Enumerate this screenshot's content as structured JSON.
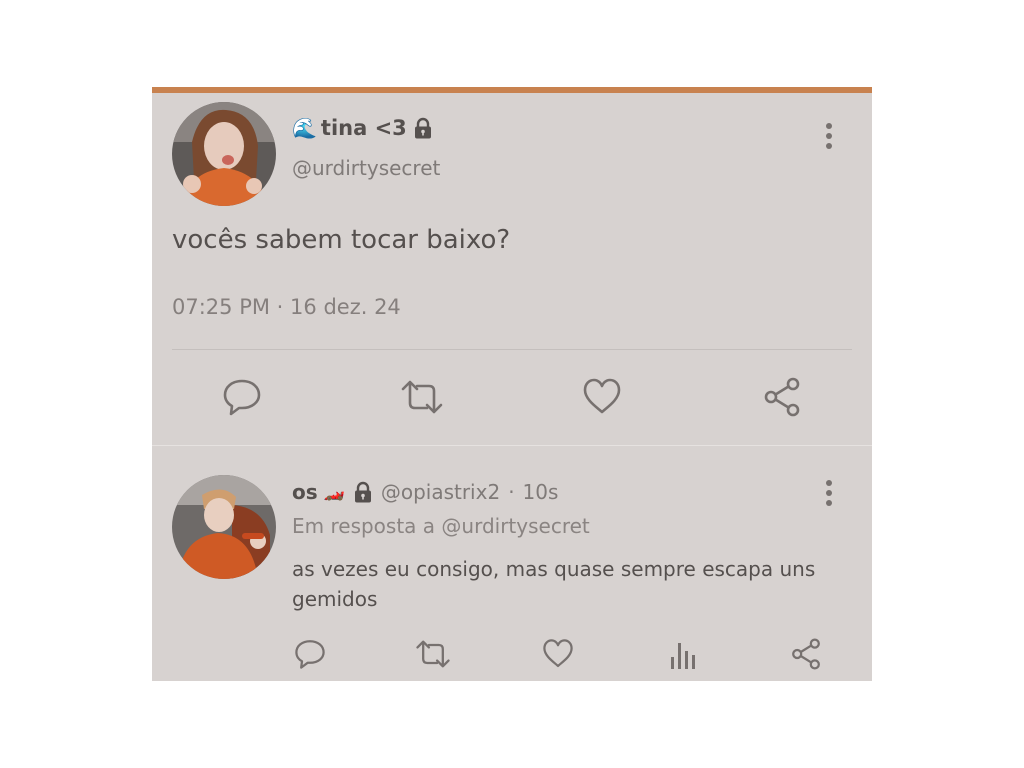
{
  "main_tweet": {
    "display_name": "tina <3",
    "name_emoji": "🌊",
    "handle": "@urdirtysecret",
    "text": "vocês sabem tocar baixo?",
    "time": "07:25 PM",
    "separator": "·",
    "date": "16 dez. 24",
    "avatar": "avatar-photo-girl",
    "menu_icon": "more-vertical-icon",
    "actions": [
      "comment-icon",
      "retweet-icon",
      "heart-icon",
      "share-icon"
    ]
  },
  "reply": {
    "display_name": "os",
    "name_emoji": "🏎️",
    "handle": "@opiastrix2",
    "separator": "·",
    "time_ago": "10s",
    "in_reply_to": "Em resposta a @urdirtysecret",
    "text": "as vezes eu consigo, mas quase sempre escapa uns gemidos",
    "avatar": "avatar-photo-boy",
    "menu_icon": "more-vertical-icon",
    "actions": [
      "comment-icon",
      "retweet-icon",
      "heart-icon",
      "stats-icon",
      "share-icon"
    ]
  },
  "colors": {
    "accent_bar": "#c8824f",
    "card_background": "#d7d2d0",
    "text_primary": "#55504e",
    "text_secondary": "#7f7a78",
    "icon": "#77716f"
  }
}
